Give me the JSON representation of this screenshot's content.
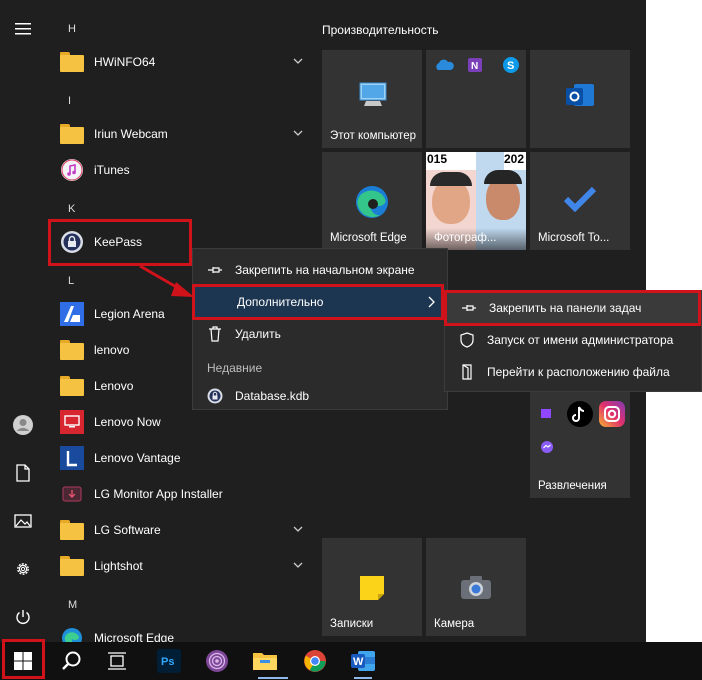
{
  "applist": {
    "h_letter": "H",
    "hwinfo": "HWiNFO64",
    "i_letter": "I",
    "iriun": "Iriun Webcam",
    "itunes": "iTunes",
    "k_letter": "K",
    "keepass": "KeePass",
    "l_letter": "L",
    "legion": "Legion Arena",
    "lenovo_folder": "lenovo",
    "lenovo_folder2": "Lenovo",
    "lenovo_now": "Lenovo Now",
    "lenovo_vantage": "Lenovo Vantage",
    "lg_monitor": "LG Monitor App Installer",
    "lg_software": "LG Software",
    "lightshot": "Lightshot",
    "m_letter": "M",
    "ms_edge": "Microsoft Edge"
  },
  "tiles": {
    "group_title": "Производительность",
    "this_pc": "Этот компьютер",
    "edge": "Microsoft Edge",
    "photos": "Фотограф...",
    "photos_year_left": "015",
    "photos_year_right": "202",
    "todo": "Microsoft To...",
    "entertainment": "Развлечения",
    "notes": "Записки",
    "camera": "Камера"
  },
  "context_menu": {
    "pin_start": "Закрепить на начальном экране",
    "more": "Дополнительно",
    "uninstall": "Удалить",
    "recent_header": "Недавние",
    "recent_file": "Database.kdb"
  },
  "submenu": {
    "pin_taskbar": "Закрепить на панели задач",
    "run_admin": "Запуск от имени администратора",
    "open_location": "Перейти к расположению файла"
  },
  "colors": {
    "highlight_red": "#d0121a",
    "menu_selected": "#1c3550",
    "tile_bg": "#333333"
  }
}
